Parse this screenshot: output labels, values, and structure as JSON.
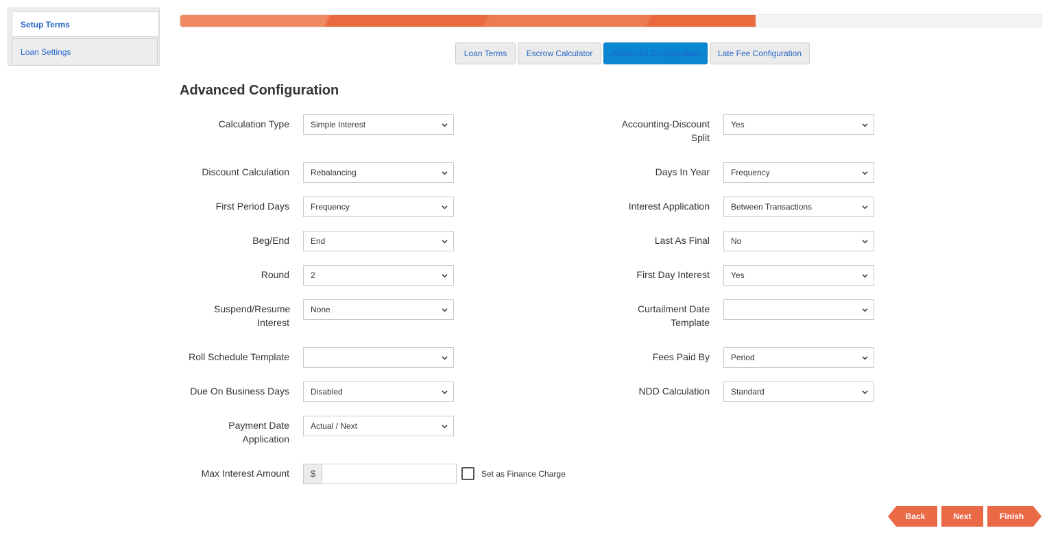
{
  "sidebar": {
    "items": [
      {
        "label": "Setup Terms",
        "active": true
      },
      {
        "label": "Loan Settings",
        "active": false
      }
    ]
  },
  "progress": {
    "percent": 66.8
  },
  "tabs": [
    {
      "label": "Loan Terms",
      "active": false
    },
    {
      "label": "Escrow Calculator",
      "active": false
    },
    {
      "label": "Advanced Configuration",
      "active": true
    },
    {
      "label": "Late Fee Configuration",
      "active": false
    }
  ],
  "page_title": "Advanced Configuration",
  "form": {
    "left": [
      {
        "label": "Calculation Type",
        "value": "Simple Interest"
      },
      {
        "label": "Discount Calculation",
        "value": "Rebalancing"
      },
      {
        "label": "First Period Days",
        "value": "Frequency"
      },
      {
        "label": "Beg/End",
        "value": "End"
      },
      {
        "label": "Round",
        "value": "2"
      },
      {
        "label": "Suspend/Resume Interest",
        "value": "None"
      },
      {
        "label": "Roll Schedule Template",
        "value": ""
      },
      {
        "label": "Due On Business Days",
        "value": "Disabled"
      },
      {
        "label": "Payment Date Application",
        "value": "Actual / Next"
      }
    ],
    "right": [
      {
        "label": "Accounting-Discount Split",
        "value": "Yes"
      },
      {
        "label": "Days In Year",
        "value": "Frequency"
      },
      {
        "label": "Interest Application",
        "value": "Between Transactions"
      },
      {
        "label": "Last As Final",
        "value": "No"
      },
      {
        "label": "First Day Interest",
        "value": "Yes"
      },
      {
        "label": "Curtailment Date Template",
        "value": ""
      },
      {
        "label": "Fees Paid By",
        "value": "Period"
      },
      {
        "label": "NDD Calculation",
        "value": "Standard"
      }
    ],
    "max_interest": {
      "label": "Max Interest Amount",
      "currency_symbol": "$",
      "value": "",
      "finance_charge_label": "Set as Finance Charge"
    }
  },
  "buttons": {
    "back": "Back",
    "next": "Next",
    "finish": "Finish"
  },
  "icons": {
    "select": "chevron-down-icon"
  },
  "colors": {
    "accent": "#ea6a48",
    "active_tab": "#0b86d0",
    "link": "#2867c4"
  }
}
